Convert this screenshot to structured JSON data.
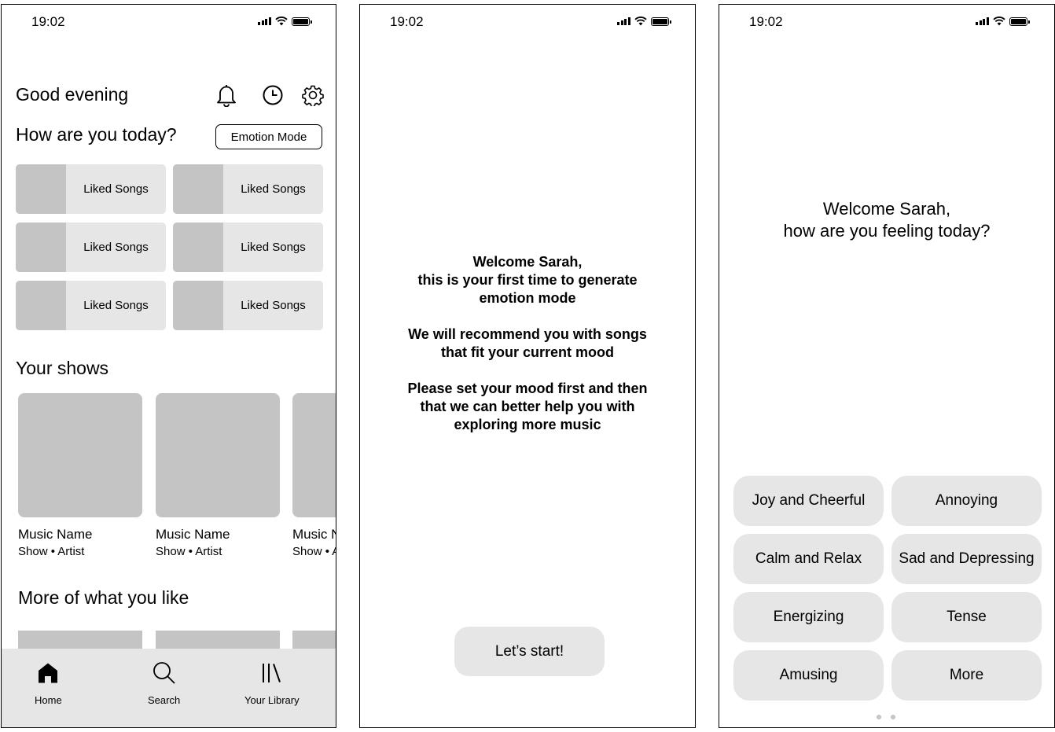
{
  "status_bar": {
    "time": "19:02"
  },
  "home": {
    "greeting": "Good evening",
    "question": "How are you today?",
    "emotion_mode_label": "Emotion Mode",
    "tiles": [
      "Liked Songs",
      "Liked Songs",
      "Liked Songs",
      "Liked Songs",
      "Liked Songs",
      "Liked Songs"
    ],
    "your_shows_title": "Your shows",
    "shows": [
      {
        "name": "Music Name",
        "sub": "Show • Artist"
      },
      {
        "name": "Music Name",
        "sub": "Show • Artist"
      },
      {
        "name": "Music Name",
        "sub": "Show • Artist"
      }
    ],
    "more_title": "More of what you like",
    "nav": {
      "home": "Home",
      "search": "Search",
      "library": "Your Library"
    }
  },
  "intro": {
    "paragraph1": [
      "Welcome Sarah,",
      "this is your first time to generate",
      "emotion mode"
    ],
    "paragraph2": [
      "We will recommend you with songs",
      "that fit your current mood"
    ],
    "paragraph3": [
      "Please set your mood first and then",
      "that we can better help you with",
      "exploring more music"
    ],
    "start_label": "Let’s start!"
  },
  "mood_select": {
    "welcome_line1": "Welcome Sarah,",
    "welcome_line2": "how are you feeling today?",
    "moods": [
      "Joy and Cheerful",
      "Annoying",
      "Calm and Relax",
      "Sad and Depressing",
      "Energizing",
      "Tense",
      "Amusing",
      "More"
    ]
  }
}
